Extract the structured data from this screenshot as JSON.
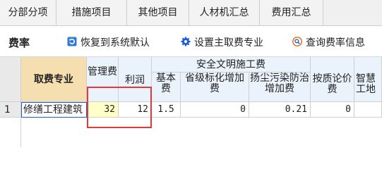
{
  "tabs": [
    {
      "label": "分部分项"
    },
    {
      "label": "措施项目"
    },
    {
      "label": "其他项目"
    },
    {
      "label": "人材机汇总"
    },
    {
      "label": "费用汇总"
    }
  ],
  "toolbar": {
    "title": "费率",
    "restore_label": "恢复到系统默认",
    "set_main_label": "设置主取费专业",
    "query_label": "查询费率信息"
  },
  "grid": {
    "headers": {
      "category": "取费专业",
      "management": "管理费",
      "profit": "利润",
      "safety_group": "安全文明施工费",
      "basic": "基本费",
      "provincial": "省级标化增加费",
      "dust": "扬尘污染防治增加费",
      "quality": "按质论价费",
      "smart": "智慧工地"
    },
    "rows": [
      {
        "num": "1",
        "category": "修缮工程建筑",
        "management": "32",
        "profit": "12",
        "basic": "1.5",
        "provincial": "0",
        "dust": "0.21",
        "quality": "0"
      }
    ]
  },
  "colors": {
    "accent": "#1e5bd7",
    "highlight": "#e53935",
    "header_bg": "#eaf2fb",
    "selected_header_bg": "#f5dfb0",
    "edited_cell_bg": "#ffffc8"
  }
}
